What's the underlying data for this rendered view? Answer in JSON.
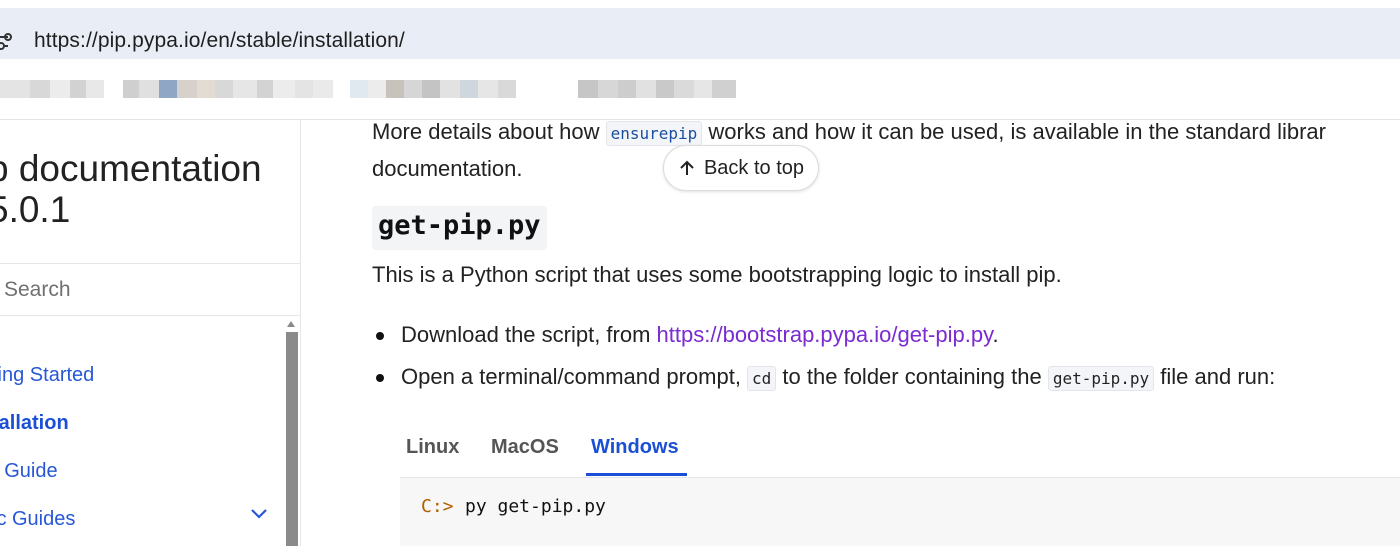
{
  "browser": {
    "url": "https://pip.pypa.io/en/stable/installation/"
  },
  "sidebar": {
    "brand_line1": "p documentation",
    "brand_line2": "5.0.1",
    "search_placeholder": "Search",
    "nav": [
      {
        "label": "ting Started"
      },
      {
        "label": "tallation"
      },
      {
        "label": "r Guide"
      },
      {
        "label": "ic Guides"
      }
    ]
  },
  "content": {
    "intro_before": "More details about how ",
    "intro_code": "ensurepip",
    "intro_after": " works and how it can be used, is available in the standard librar",
    "intro_line2": "documentation.",
    "back_to_top": "Back to top",
    "heading": "get-pip.py",
    "paragraph": "This is a Python script that uses some bootstrapping logic to install pip.",
    "bullet1_before": "Download the script, from ",
    "bullet1_link": "https://bootstrap.pypa.io/get-pip.py",
    "bullet1_after": ".",
    "bullet2_a": "Open a terminal/command prompt, ",
    "bullet2_code1": "cd",
    "bullet2_b": " to the folder containing the ",
    "bullet2_code2": "get-pip.py",
    "bullet2_c": " file and run:",
    "tabs": [
      {
        "label": "Linux"
      },
      {
        "label": "MacOS"
      },
      {
        "label": "Windows",
        "active": true
      }
    ],
    "code_prompt": "C:>",
    "code_command": "py get-pip.py"
  },
  "colors": {
    "link": "#7a2bd1",
    "nav": "#2757d6",
    "active_tab": "#1a4fd6"
  }
}
